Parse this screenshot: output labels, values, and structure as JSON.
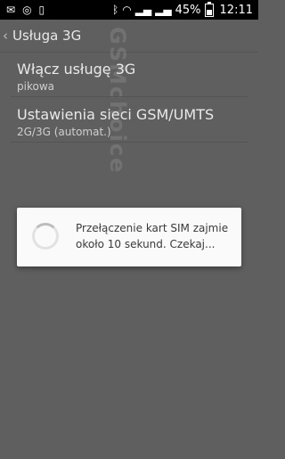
{
  "status_bar": {
    "battery_percent": "45%",
    "time": "12:11",
    "icons": [
      "notification-icon",
      "target-icon",
      "sim-card-icon",
      "bluetooth-icon",
      "wifi-icon",
      "signal-icon",
      "signal-icon",
      "battery-icon"
    ]
  },
  "header": {
    "title": "Usługa 3G"
  },
  "settings": [
    {
      "title": "Włącz usługę 3G",
      "subtitle": "pikowa"
    },
    {
      "title": "Ustawienia sieci GSM/UMTS",
      "subtitle": "2G/3G (automat.)"
    }
  ],
  "dialog": {
    "message": "Przełączenie kart SIM zajmie około 10 sekund. Czekaj..."
  },
  "watermark": "GSMchoice"
}
